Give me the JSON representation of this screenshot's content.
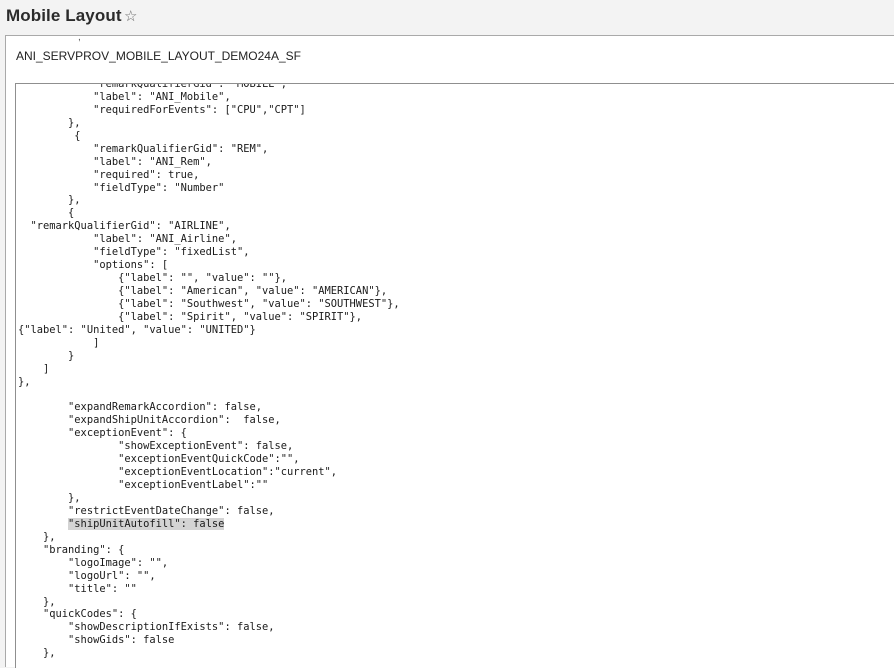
{
  "header": {
    "title": "Mobile Layout",
    "favorite_icon": "star-outline-icon"
  },
  "layout": {
    "name": "ANI_SERVPROV_MOBILE_LAYOUT_DEMO24A_SF"
  },
  "editor": {
    "highlighted_text": "\"shipUnitAutofill\": false",
    "lines": [
      "            \"remarkQualifierGid\": \"MOBILE\",",
      "            \"label\": \"ANI_Mobile\",",
      "            \"requiredForEvents\": [\"CPU\",\"CPT\"]",
      "        },",
      "         {",
      "            \"remarkQualifierGid\": \"REM\",",
      "            \"label\": \"ANI_Rem\",",
      "            \"required\": true,",
      "            \"fieldType\": \"Number\"",
      "        },",
      "        {",
      "  \"remarkQualifierGid\": \"AIRLINE\",",
      "            \"label\": \"ANI_Airline\",",
      "            \"fieldType\": \"fixedList\",",
      "            \"options\": [",
      "                {\"label\": \"\", \"value\": \"\"},",
      "                {\"label\": \"American\", \"value\": \"AMERICAN\"},",
      "                {\"label\": \"Southwest\", \"value\": \"SOUTHWEST\"},",
      "                {\"label\": \"Spirit\", \"value\": \"SPIRIT\"},",
      "{\"label\": \"United\", \"value\": \"UNITED\"}",
      "            ]",
      "        }",
      "    ]",
      "},",
      "",
      "        \"expandRemarkAccordion\": false,",
      "        \"expandShipUnitAccordion\":  false,",
      "        \"exceptionEvent\": {",
      "                \"showExceptionEvent\": false,",
      "                \"exceptionEventQuickCode\":\"\",",
      "                \"exceptionEventLocation\":\"current\",",
      "                \"exceptionEventLabel\":\"\"",
      "        },",
      "        \"restrictEventDateChange\": false,",
      "        \"shipUnitAutofill\": false",
      "    },",
      "    \"branding\": {",
      "        \"logoImage\": \"\",",
      "        \"logoUrl\": \"\",",
      "        \"title\": \"\"",
      "    },",
      "    \"quickCodes\": {",
      "        \"showDescriptionIfExists\": false,",
      "        \"showGids\": false",
      "    },"
    ]
  }
}
